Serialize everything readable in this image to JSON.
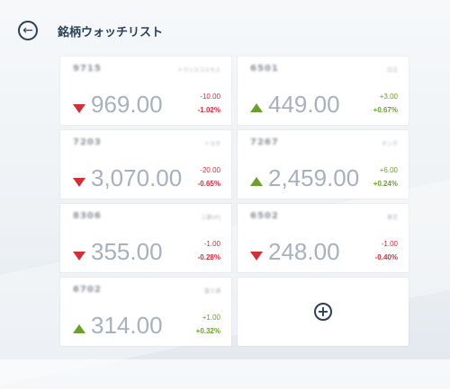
{
  "header": {
    "title": "銘柄ウォッチリスト",
    "back_icon": "back-arrow-icon"
  },
  "colors": {
    "down": "#d1303a",
    "up": "#6aa12d",
    "accent": "#2a3f58"
  },
  "stocks": [
    {
      "code": "9715",
      "name": "トランスコスモス",
      "price": "969.00",
      "change": "-10.00",
      "percent": "-1.02%",
      "direction": "down"
    },
    {
      "code": "6501",
      "name": "日立",
      "price": "449.00",
      "change": "+3.00",
      "percent": "+0.67%",
      "direction": "up"
    },
    {
      "code": "7203",
      "name": "トヨタ",
      "price": "3,070.00",
      "change": "-20.00",
      "percent": "-0.65%",
      "direction": "down"
    },
    {
      "code": "7267",
      "name": "ホンダ",
      "price": "2,459.00",
      "change": "+6.00",
      "percent": "+0.24%",
      "direction": "up"
    },
    {
      "code": "8306",
      "name": "三菱UFJ",
      "price": "355.00",
      "change": "-1.00",
      "percent": "-0.28%",
      "direction": "down"
    },
    {
      "code": "6502",
      "name": "東芝",
      "price": "248.00",
      "change": "-1.00",
      "percent": "-0.40%",
      "direction": "down"
    },
    {
      "code": "6702",
      "name": "富士通",
      "price": "314.00",
      "change": "+1.00",
      "percent": "+0.32%",
      "direction": "up"
    }
  ],
  "add_button": {
    "icon": "plus-circle-icon",
    "symbol": "+"
  }
}
